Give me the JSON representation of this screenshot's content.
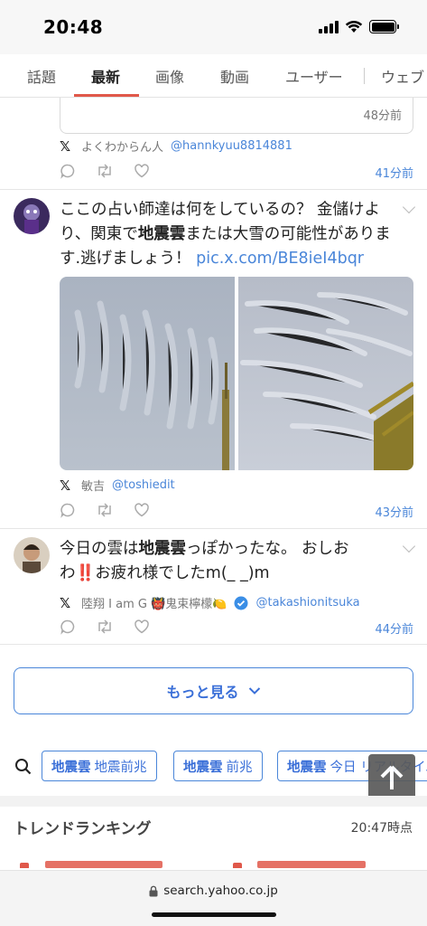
{
  "status_bar": {
    "time": "20:48"
  },
  "tabs": [
    {
      "label": "話題",
      "active": false
    },
    {
      "label": "最新",
      "active": true
    },
    {
      "label": "画像",
      "active": false
    },
    {
      "label": "動画",
      "active": false
    },
    {
      "label": "ユーザー",
      "active": false
    },
    {
      "label": "ウェブ",
      "active": false
    }
  ],
  "quoted_card": {
    "time": "48分前"
  },
  "posts": [
    {
      "author_name": "よくわからん人",
      "handle": "@hannkyuu8814881",
      "time": "41分前"
    },
    {
      "text_line1": "ここの占い師達は何をしているの？ 金儲けよ",
      "text_line2_pre": "り、関東で",
      "text_line2_bold": "地震雲",
      "text_line2_post": "または大雪の可能性がありま",
      "text_line3": "す.逃げましょう！ ",
      "link": "pic.x.com/BE8ieI4bqr",
      "author_name": "敏吉",
      "handle": "@toshiedit",
      "time": "43分前"
    },
    {
      "text_line1_pre": "今日の雲は",
      "text_line1_bold": "地震雲",
      "text_line1_post": "っぽかったな。 おしお",
      "text_line2_pre": "わ",
      "text_line2_emoji": "‼️",
      "text_line2_post": "お疲れ様でしたm(_ _)m",
      "author_name_pre": "陸翔 I am G ",
      "author_emoji1": "👹",
      "author_name_mid": "鬼束檸檬",
      "author_emoji2": "🍋",
      "handle": "@takashionitsuka",
      "time": "44分前"
    }
  ],
  "more_button": {
    "label": "もっと見る"
  },
  "related_searches": [
    {
      "bold": "地震雲",
      "rest": "地震前兆"
    },
    {
      "bold": "地震雲",
      "rest": "前兆"
    },
    {
      "bold": "地震雲",
      "rest": "今日 リアルタイム"
    }
  ],
  "trend": {
    "title": "トレンドランキング",
    "time": "20:47時点"
  },
  "url_bar": {
    "url": "search.yahoo.co.jp"
  },
  "colors": {
    "accent_blue": "#4a86d9",
    "tab_underline": "#e0584a"
  },
  "icons": [
    "x-logo-icon",
    "reply-icon",
    "retweet-icon",
    "like-icon",
    "search-icon",
    "lock-icon",
    "arrow-up-icon",
    "chevron-down-icon",
    "verified-icon"
  ]
}
